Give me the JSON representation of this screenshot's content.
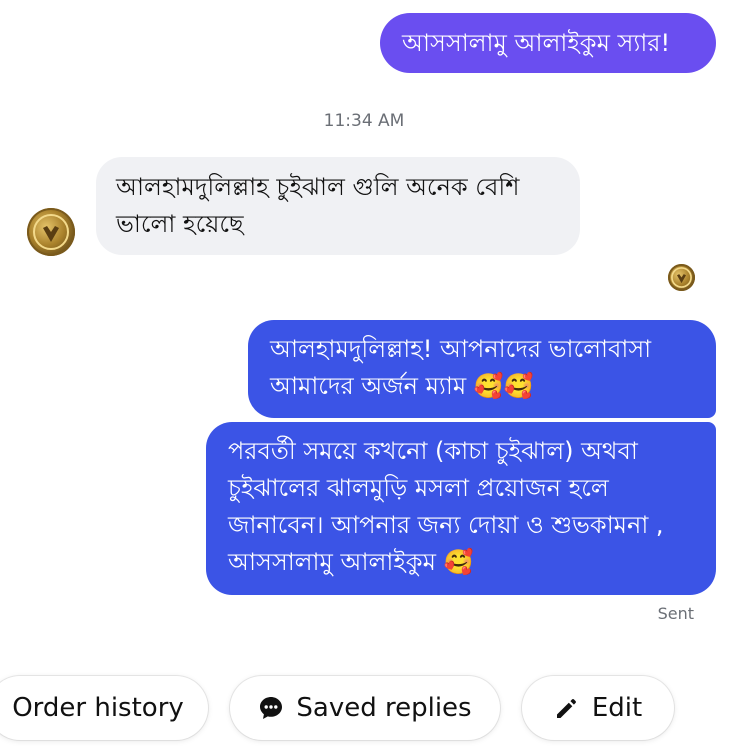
{
  "messages": [
    {
      "direction": "outgoing",
      "text": "আসসালামু আলাইকুম স্যার!"
    },
    {
      "direction": "incoming",
      "text": "আলহামদুলিল্লাহ চুইঝাল গুলি অনেক বেশি\nভালো হয়েছে"
    },
    {
      "direction": "outgoing",
      "text": "আলহামদুলিল্লাহ!  আপনাদের ভালোবাসা\nআমাদের অর্জন ম্যাম 🥰🥰"
    },
    {
      "direction": "outgoing",
      "text": "পরবর্তী সময়ে কখনো (কাচা চুইঝাল) অথবা\nচুইঝালের ঝালমুড়ি মসলা প্রয়োজন হলে\nজানাবেন। আপনার জন্য দোয়া ও শুভকামনা ,\nআসসালামু আলাইকুম 🥰"
    }
  ],
  "timestamp": "11:34 AM",
  "status": "Sent",
  "actions": {
    "order_history": "Order history",
    "saved_replies": "Saved replies",
    "edit": "Edit"
  },
  "colors": {
    "outgoing_first": "#6a4ef0",
    "outgoing": "#3b54e6",
    "incoming": "#f0f1f4",
    "meta_text": "#6b6f76"
  },
  "icons": {
    "saved_replies": "chat-bubble-dots-icon",
    "edit": "pencil-icon",
    "avatar": "profile-avatar"
  }
}
